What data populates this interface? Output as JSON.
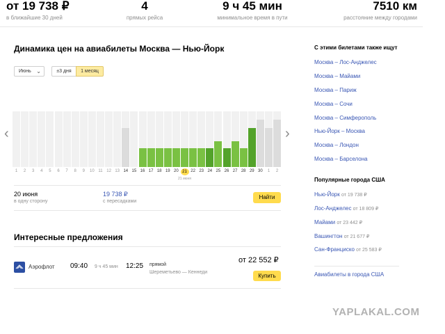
{
  "stats": {
    "price": "от 19 738 ₽",
    "price_sub": "в ближайшие 30 дней",
    "flights": "4",
    "flights_sub": "прямых рейса",
    "time": "9 ч 45 мин",
    "time_sub": "минимальное время в пути",
    "distance": "7510 км",
    "distance_sub": "расстояние между городами"
  },
  "chart_section": {
    "title": "Динамика цен на авиабилеты Москва — Нью-Йорк",
    "month_select": "Июнь",
    "range_options": [
      "±3 дня",
      "1 месяц"
    ],
    "selected_range": "1 месяц",
    "selected_month_label": "21 июня"
  },
  "chart_data": {
    "type": "bar",
    "title": "",
    "xlabel": "",
    "ylabel": "",
    "categories": [
      "1",
      "2",
      "3",
      "4",
      "5",
      "6",
      "7",
      "8",
      "9",
      "10",
      "11",
      "12",
      "13",
      "14",
      "15",
      "16",
      "17",
      "18",
      "19",
      "20",
      "21",
      "22",
      "23",
      "24",
      "25",
      "26",
      "27",
      "28",
      "29",
      "30",
      "1",
      "2"
    ],
    "values": [
      null,
      null,
      null,
      null,
      null,
      null,
      null,
      null,
      null,
      null,
      null,
      null,
      null,
      0.45,
      null,
      0.22,
      0.22,
      0.22,
      0.22,
      0.22,
      0.22,
      0.22,
      0.22,
      0.22,
      0.3,
      0.22,
      0.3,
      0.22,
      0.45,
      0.55,
      0.45,
      0.55
    ],
    "value_note_units": "relative bar height (no y-axis printed)",
    "bar_colors": {
      "priced": "#7ac143",
      "highlight": "#53a32a",
      "other": "#dcdcdc",
      "empty": "#f1f1f1"
    },
    "highlighted_days": [
      "24",
      "26"
    ],
    "weekend_days_red": [
      "17",
      "18",
      "24",
      "25"
    ],
    "selected_day": "21"
  },
  "selection": {
    "date": "20 июня",
    "date_sub": "в одну сторону",
    "price": "19 738 ₽",
    "price_sub": "с пересадками",
    "find_label": "Найти"
  },
  "offers": {
    "title": "Интересные предложения",
    "airline": "Аэрофлот",
    "depart": "09:40",
    "duration": "9 ч 45 мин",
    "arrive": "12:25",
    "type": "прямой",
    "airports": "Шереметьево — Кеннеди",
    "price": "от 22 552 ₽",
    "buy_label": "Купить"
  },
  "sidebar": {
    "also_title": "С этими билетами также ищут",
    "also_links": [
      "Москва – Лос-Анджелес",
      "Москва – Майами",
      "Москва – Париж",
      "Москва – Сочи",
      "Москва – Симферополь",
      "Нью-Йорк – Москва",
      "Москва – Лондон",
      "Москва – Барселона"
    ],
    "popular_title": "Популярные города США",
    "popular": [
      {
        "city": "Нью-Йорк",
        "price": "от 19 738 ₽"
      },
      {
        "city": "Лос-Анджелес",
        "price": "от 18 809 ₽"
      },
      {
        "city": "Майами",
        "price": "от 23 442 ₽"
      },
      {
        "city": "Вашингтон",
        "price": "от 21 677 ₽"
      },
      {
        "city": "Сан-Франциско",
        "price": "от 25 583 ₽"
      }
    ],
    "usa_link": "Авиабилеты в города США"
  },
  "watermark": "YAPLAKAL.COM"
}
